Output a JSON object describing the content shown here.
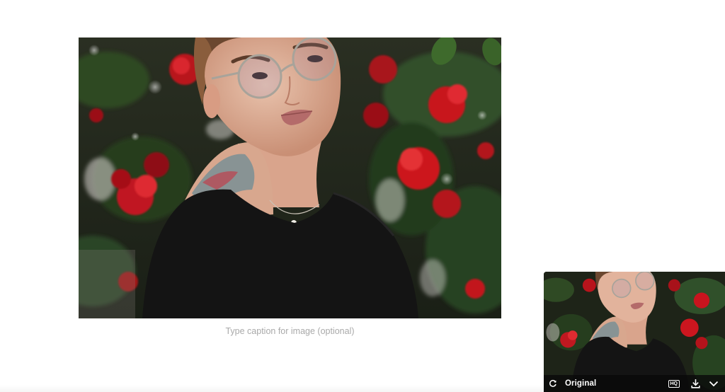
{
  "editor": {
    "caption_placeholder": "Type caption for image (optional)"
  },
  "preview": {
    "label": "Original",
    "quality_badge": "HQ",
    "icons": {
      "rotate": "rotate-icon",
      "download": "download-icon",
      "collapse": "chevron-down-icon"
    }
  },
  "colors": {
    "background": "#ffffff",
    "caption_text": "#a9a9a9",
    "preview_bar": "#0a0a0a",
    "rose_red": "#c8141e"
  }
}
